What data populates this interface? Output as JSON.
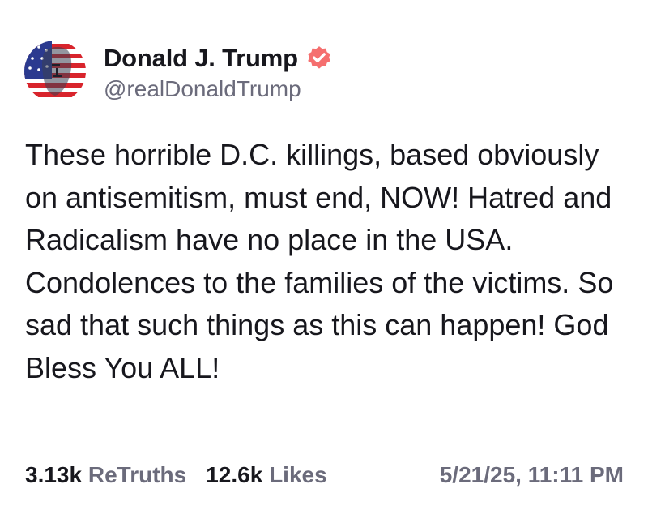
{
  "author": {
    "display_name": "Donald J. Trump",
    "handle": "@realDonaldTrump",
    "avatar_icon": "avatar-american-flag-portrait",
    "verified_icon": "verified-badge-icon"
  },
  "post": {
    "text": "These horrible D.C. killings, based obviously on antisemitism, must end, NOW! Hatred and Radicalism have no place in the USA. Condolences to the families of the victims. So sad that such things as this can happen! God Bless You ALL!"
  },
  "stats": {
    "retruths_count": "3.13k",
    "retruths_label": "ReTruths",
    "likes_count": "12.6k",
    "likes_label": "Likes"
  },
  "timestamp": "5/21/25, 11:11 PM",
  "colors": {
    "text": "#17171d",
    "secondary": "#6b6b7b",
    "verified": "#f56f6f",
    "flag_red": "#d8242c",
    "flag_blue": "#2b3a8f"
  }
}
